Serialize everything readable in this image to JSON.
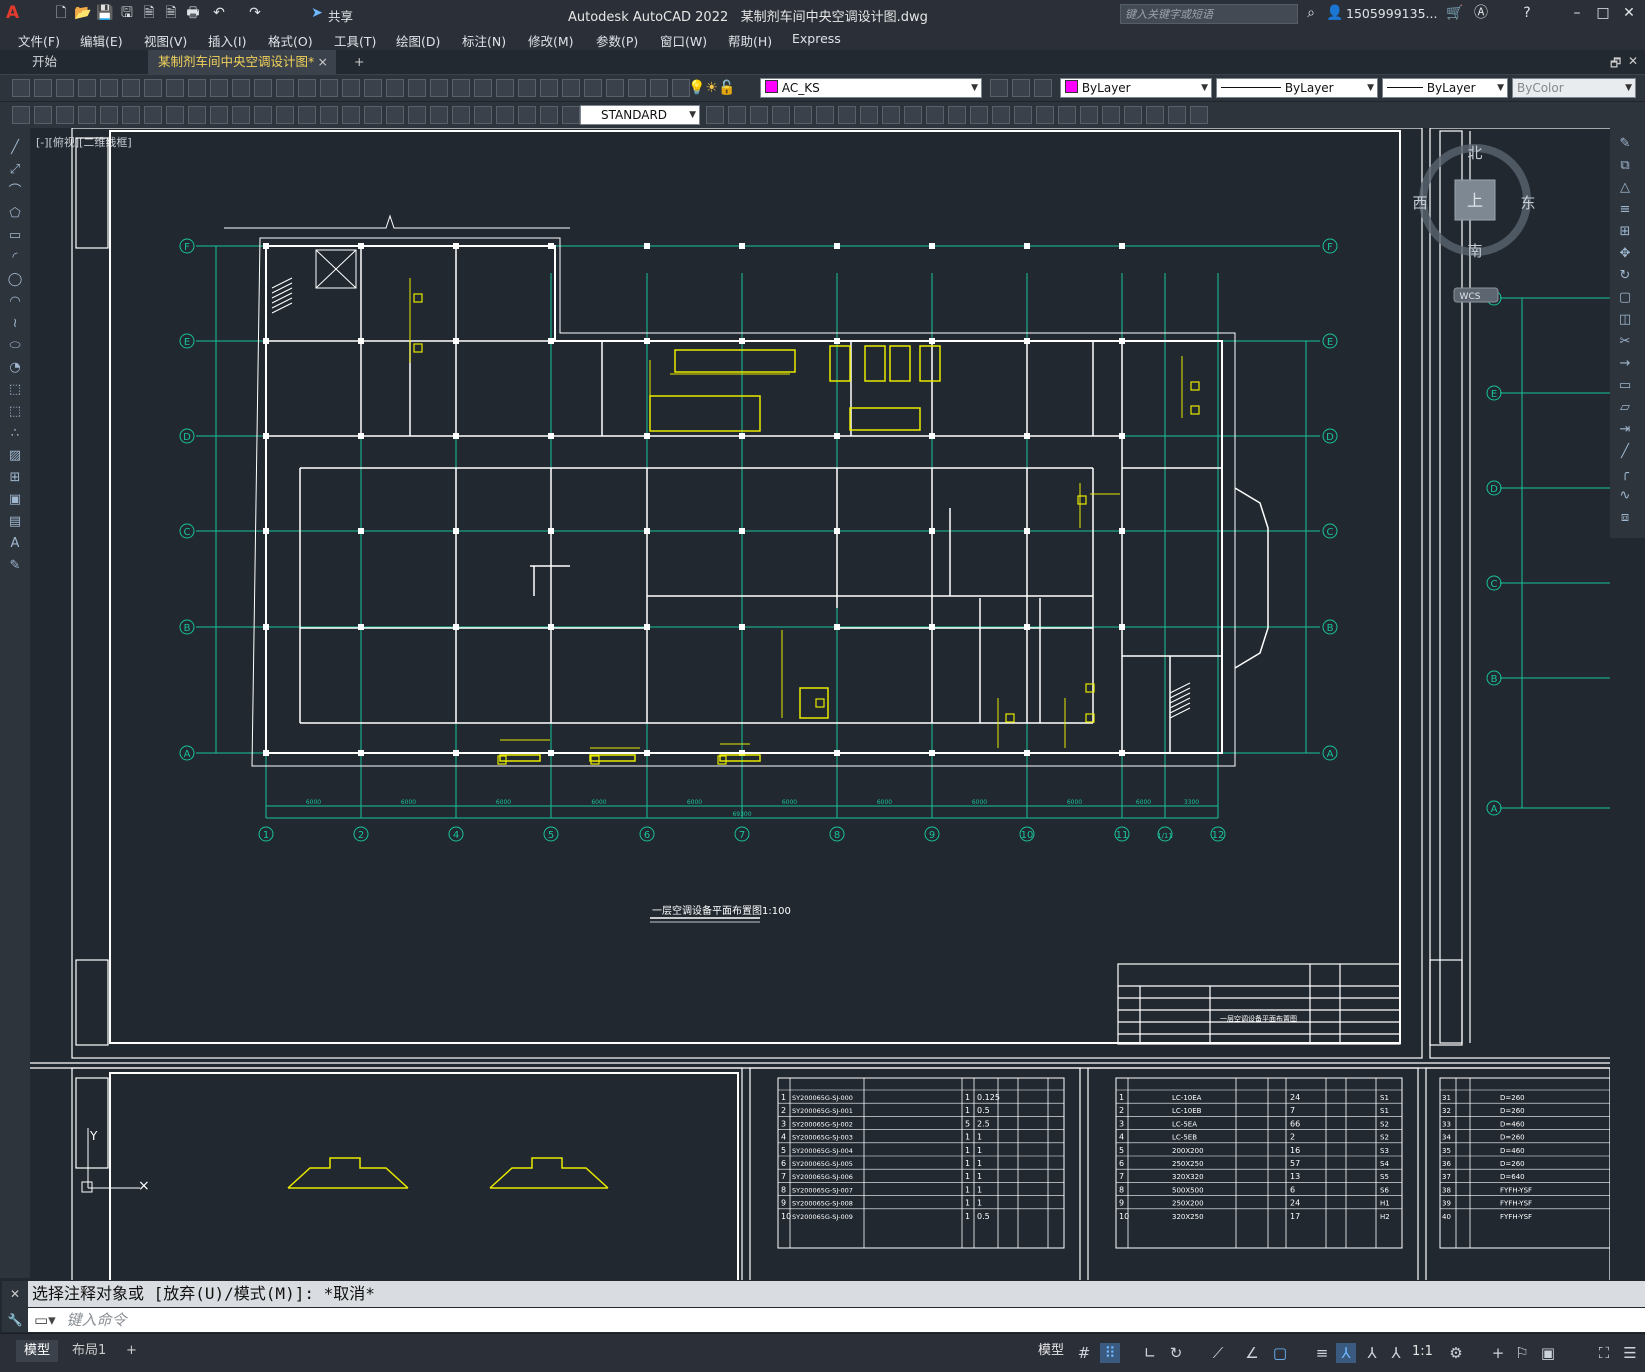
{
  "titlebar": {
    "app_name": "Autodesk AutoCAD 2022",
    "file_name": "某制剂车间中央空调设计图.dwg",
    "share_label": "共享",
    "search_placeholder": "键入关键字或短语",
    "user": "1505999135...",
    "logo": "A"
  },
  "menu": [
    "文件(F)",
    "编辑(E)",
    "视图(V)",
    "插入(I)",
    "格式(O)",
    "工具(T)",
    "绘图(D)",
    "标注(N)",
    "修改(M)",
    "参数(P)",
    "窗口(W)",
    "帮助(H)",
    "Express"
  ],
  "tabs": {
    "start": "开始",
    "active": "某制剂车间中央空调设计图*",
    "close": "×",
    "add": "+"
  },
  "toolbar": {
    "layer": "AC_KS",
    "color": "ByLayer",
    "linetype": "ByLayer",
    "lineweight": "ByLayer",
    "plotstyle": "ByColor",
    "textstyle": "STANDARD"
  },
  "viewport_label": "[-][俯视][二维线框]",
  "viewcube": {
    "north": "北",
    "south": "南",
    "east": "东",
    "west": "西",
    "top": "上",
    "wcs": "WCS"
  },
  "drawing": {
    "title": "一层空调设备平面布置图1:100",
    "grid_rows": [
      "F",
      "E",
      "D",
      "C",
      "B",
      "A"
    ],
    "grid_cols": [
      "1",
      "2",
      "4",
      "5",
      "6",
      "7",
      "8",
      "9",
      "10",
      "11",
      "1/11",
      "12"
    ],
    "right_rows": [
      "F",
      "E",
      "D",
      "C",
      "B",
      "A"
    ],
    "bottom_dims": [
      "6000",
      "6000",
      "6000",
      "6000",
      "6000",
      "6000",
      "6000",
      "6000",
      "6000",
      "6000",
      "3300"
    ],
    "total_dim": "69300",
    "title_block_name": "一层空调设备平面布置图"
  },
  "drawing_list": {
    "rows": [
      {
        "no": "1",
        "code": "SY200065G-SJ-000",
        "qty": "1",
        "size": "0.125"
      },
      {
        "no": "2",
        "code": "SY200065G-SJ-001",
        "qty": "1",
        "size": "0.5"
      },
      {
        "no": "3",
        "code": "SY200065G-SJ-002",
        "qty": "5",
        "size": "2.5"
      },
      {
        "no": "4",
        "code": "SY200065G-SJ-003",
        "qty": "1",
        "size": "1"
      },
      {
        "no": "5",
        "code": "SY200065G-SJ-004",
        "qty": "1",
        "size": "1"
      },
      {
        "no": "6",
        "code": "SY200065G-SJ-005",
        "qty": "1",
        "size": "1"
      },
      {
        "no": "7",
        "code": "SY200065G-SJ-006",
        "qty": "1",
        "size": "1"
      },
      {
        "no": "8",
        "code": "SY200065G-SJ-007",
        "qty": "1",
        "size": "1"
      },
      {
        "no": "9",
        "code": "SY200065G-SJ-008",
        "qty": "1",
        "size": "1"
      },
      {
        "no": "10",
        "code": "SY200065G-SJ-009",
        "qty": "1",
        "size": "0.5"
      }
    ]
  },
  "equipment_list": {
    "rows": [
      {
        "no": "1",
        "model": "LC-10EA",
        "qty": "24",
        "code": "S1"
      },
      {
        "no": "2",
        "model": "LC-10EB",
        "qty": "7",
        "code": "S1"
      },
      {
        "no": "3",
        "model": "LC-5EA",
        "qty": "66",
        "code": "S2"
      },
      {
        "no": "4",
        "model": "LC-5EB",
        "qty": "2",
        "code": "S2"
      },
      {
        "no": "5",
        "model": "200X200",
        "qty": "16",
        "code": "S3"
      },
      {
        "no": "6",
        "model": "250X250",
        "qty": "57",
        "code": "S4"
      },
      {
        "no": "7",
        "model": "320X320",
        "qty": "13",
        "code": "S5"
      },
      {
        "no": "8",
        "model": "500X500",
        "qty": "6",
        "code": "S6"
      },
      {
        "no": "9",
        "model": "250X200",
        "qty": "24",
        "code": "H1"
      },
      {
        "no": "10",
        "model": "320X250",
        "qty": "17",
        "code": "H2"
      }
    ]
  },
  "extra_list": {
    "rows": [
      {
        "no": "31",
        "model": "D=260"
      },
      {
        "no": "32",
        "model": "D=260"
      },
      {
        "no": "33",
        "model": "D=460"
      },
      {
        "no": "34",
        "model": "D=260"
      },
      {
        "no": "35",
        "model": "D=460"
      },
      {
        "no": "36",
        "model": "D=260"
      },
      {
        "no": "37",
        "model": "D=640"
      },
      {
        "no": "38",
        "model": "FYFH-YSF"
      },
      {
        "no": "39",
        "model": "FYFH-YSF"
      },
      {
        "no": "40",
        "model": "FYFH-YSF"
      }
    ]
  },
  "command": {
    "history": "选择注释对象或 [放弃(U)/模式(M)]: *取消*",
    "placeholder": "键入命令"
  },
  "statusbar": {
    "model_tab": "模型",
    "layout_tab": "布局1",
    "model_label": "模型",
    "scale": "1:1"
  },
  "colors": {
    "grid": "#19c39a",
    "walls": "#ffffff",
    "equipment": "#e8e800",
    "background": "#212830"
  }
}
